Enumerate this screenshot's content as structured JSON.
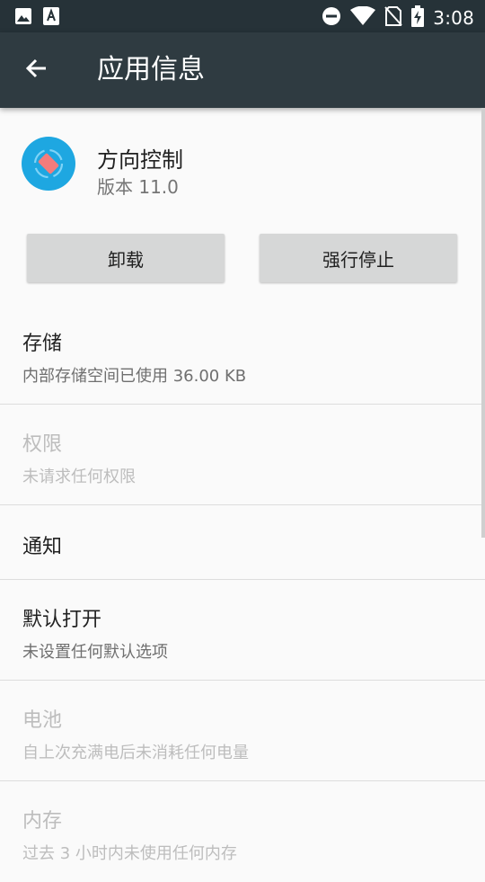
{
  "status_bar": {
    "time": "3:08",
    "left_icons": [
      "image-icon",
      "font-icon"
    ],
    "right_icons": [
      "do-not-disturb-icon",
      "wifi-icon",
      "no-sim-icon",
      "battery-charging-icon"
    ]
  },
  "toolbar": {
    "title": "应用信息"
  },
  "app": {
    "name": "方向控制",
    "version": "版本 11.0"
  },
  "buttons": {
    "uninstall": "卸载",
    "force_stop": "强行停止"
  },
  "items": [
    {
      "title": "存储",
      "subtitle": "内部存储空间已使用 36.00 KB",
      "disabled": false
    },
    {
      "title": "权限",
      "subtitle": "未请求任何权限",
      "disabled": true
    },
    {
      "title": "通知",
      "subtitle": "",
      "disabled": false
    },
    {
      "title": "默认打开",
      "subtitle": "未设置任何默认选项",
      "disabled": false
    },
    {
      "title": "电池",
      "subtitle": "自上次充满电后未消耗任何电量",
      "disabled": true
    },
    {
      "title": "内存",
      "subtitle": "过去 3 小时内未使用任何内存",
      "disabled": true
    }
  ],
  "colors": {
    "status_bar": "#263238",
    "toolbar": "#2f3b41",
    "accent": "#1ea7e1"
  }
}
